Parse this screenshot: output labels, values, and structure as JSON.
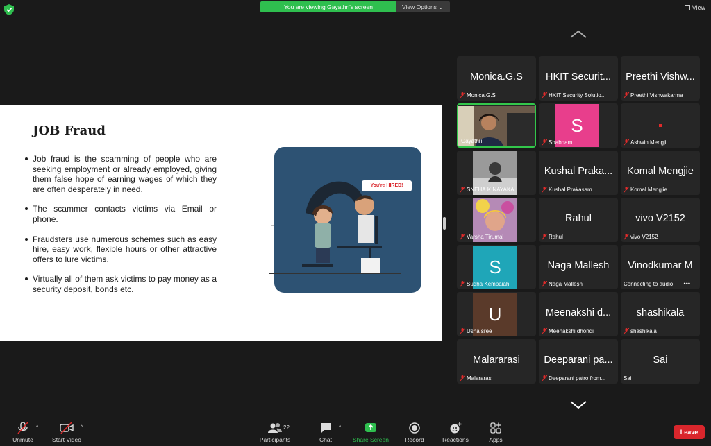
{
  "top": {
    "banner_text": "You are viewing Gayathri's screen",
    "view_options": "View Options ⌄",
    "view_label": "View"
  },
  "slide": {
    "title": "JOB Fraud",
    "bullets": [
      "Job fraud is the scamming of people who are seeking employment or already employed, giving them false hope of earning wages of which they are often desperately in need.",
      "The scammer contacts victims via Email or phone.",
      "Fraudsters use numerous schemes such as easy hire, easy work, flexible hours or other attractive offers to lure victims.",
      "Virtually all of them ask victims to pay money as a security deposit, bonds etc."
    ],
    "hired_text": "You're HIRED!",
    "arrow": "→"
  },
  "gallery": {
    "tiles": [
      {
        "big": "Monica.G.S",
        "label": "Monica.G.S"
      },
      {
        "big": "HKIT Securit...",
        "label": "HKIT Security Solutio..."
      },
      {
        "big": "Preethi Vishw...",
        "label": "Preethi Vishwakarma"
      },
      {
        "big": "",
        "label": "Gayathri"
      },
      {
        "big": "",
        "label": "Shabnam",
        "avatar_letter": "S",
        "avatar_color": "#e83e8c"
      },
      {
        "big": "",
        "label": "Ashwin Mengji"
      },
      {
        "big": "",
        "label": "SNEHA.K NAYAKA"
      },
      {
        "big": "Kushal Praka...",
        "label": "Kushal Prakasam"
      },
      {
        "big": "Komal Mengjie",
        "label": "Komal Mengjie"
      },
      {
        "big": "",
        "label": "Varsha Tirumal"
      },
      {
        "big": "Rahul",
        "label": "Rahul"
      },
      {
        "big": "vivo V2152",
        "label": "vivo V2152"
      },
      {
        "big": "",
        "label": "Sudha Kempaiah",
        "avatar_letter": "S",
        "avatar_color": "#1fa6b8"
      },
      {
        "big": "Naga Mallesh",
        "label": "Naga Mallesh"
      },
      {
        "big": "Vinodkumar M",
        "label": "Connecting to audio",
        "more": "•••"
      },
      {
        "big": "",
        "label": "Usha sree",
        "avatar_letter": "U",
        "avatar_color": "#5a3a2a"
      },
      {
        "big": "Meenakshi d...",
        "label": "Meenakshi dhondi"
      },
      {
        "big": "shashikala",
        "label": "shashikala"
      },
      {
        "big": "Malararasi",
        "label": "Malararasi"
      },
      {
        "big": "Deeparani pa...",
        "label": "Deeparani patro from..."
      },
      {
        "big": "Sai",
        "label": "Sai"
      }
    ]
  },
  "toolbar": {
    "unmute": "Unmute",
    "start_video": "Start Video",
    "participants": "Participants",
    "participants_count": "22",
    "chat": "Chat",
    "share_screen": "Share Screen",
    "record": "Record",
    "reactions": "Reactions",
    "apps": "Apps",
    "leave": "Leave",
    "caret": "^"
  },
  "colors": {
    "active_speaker": "#33c74b",
    "banner": "#2fbf4f",
    "leave": "#d9262c"
  }
}
